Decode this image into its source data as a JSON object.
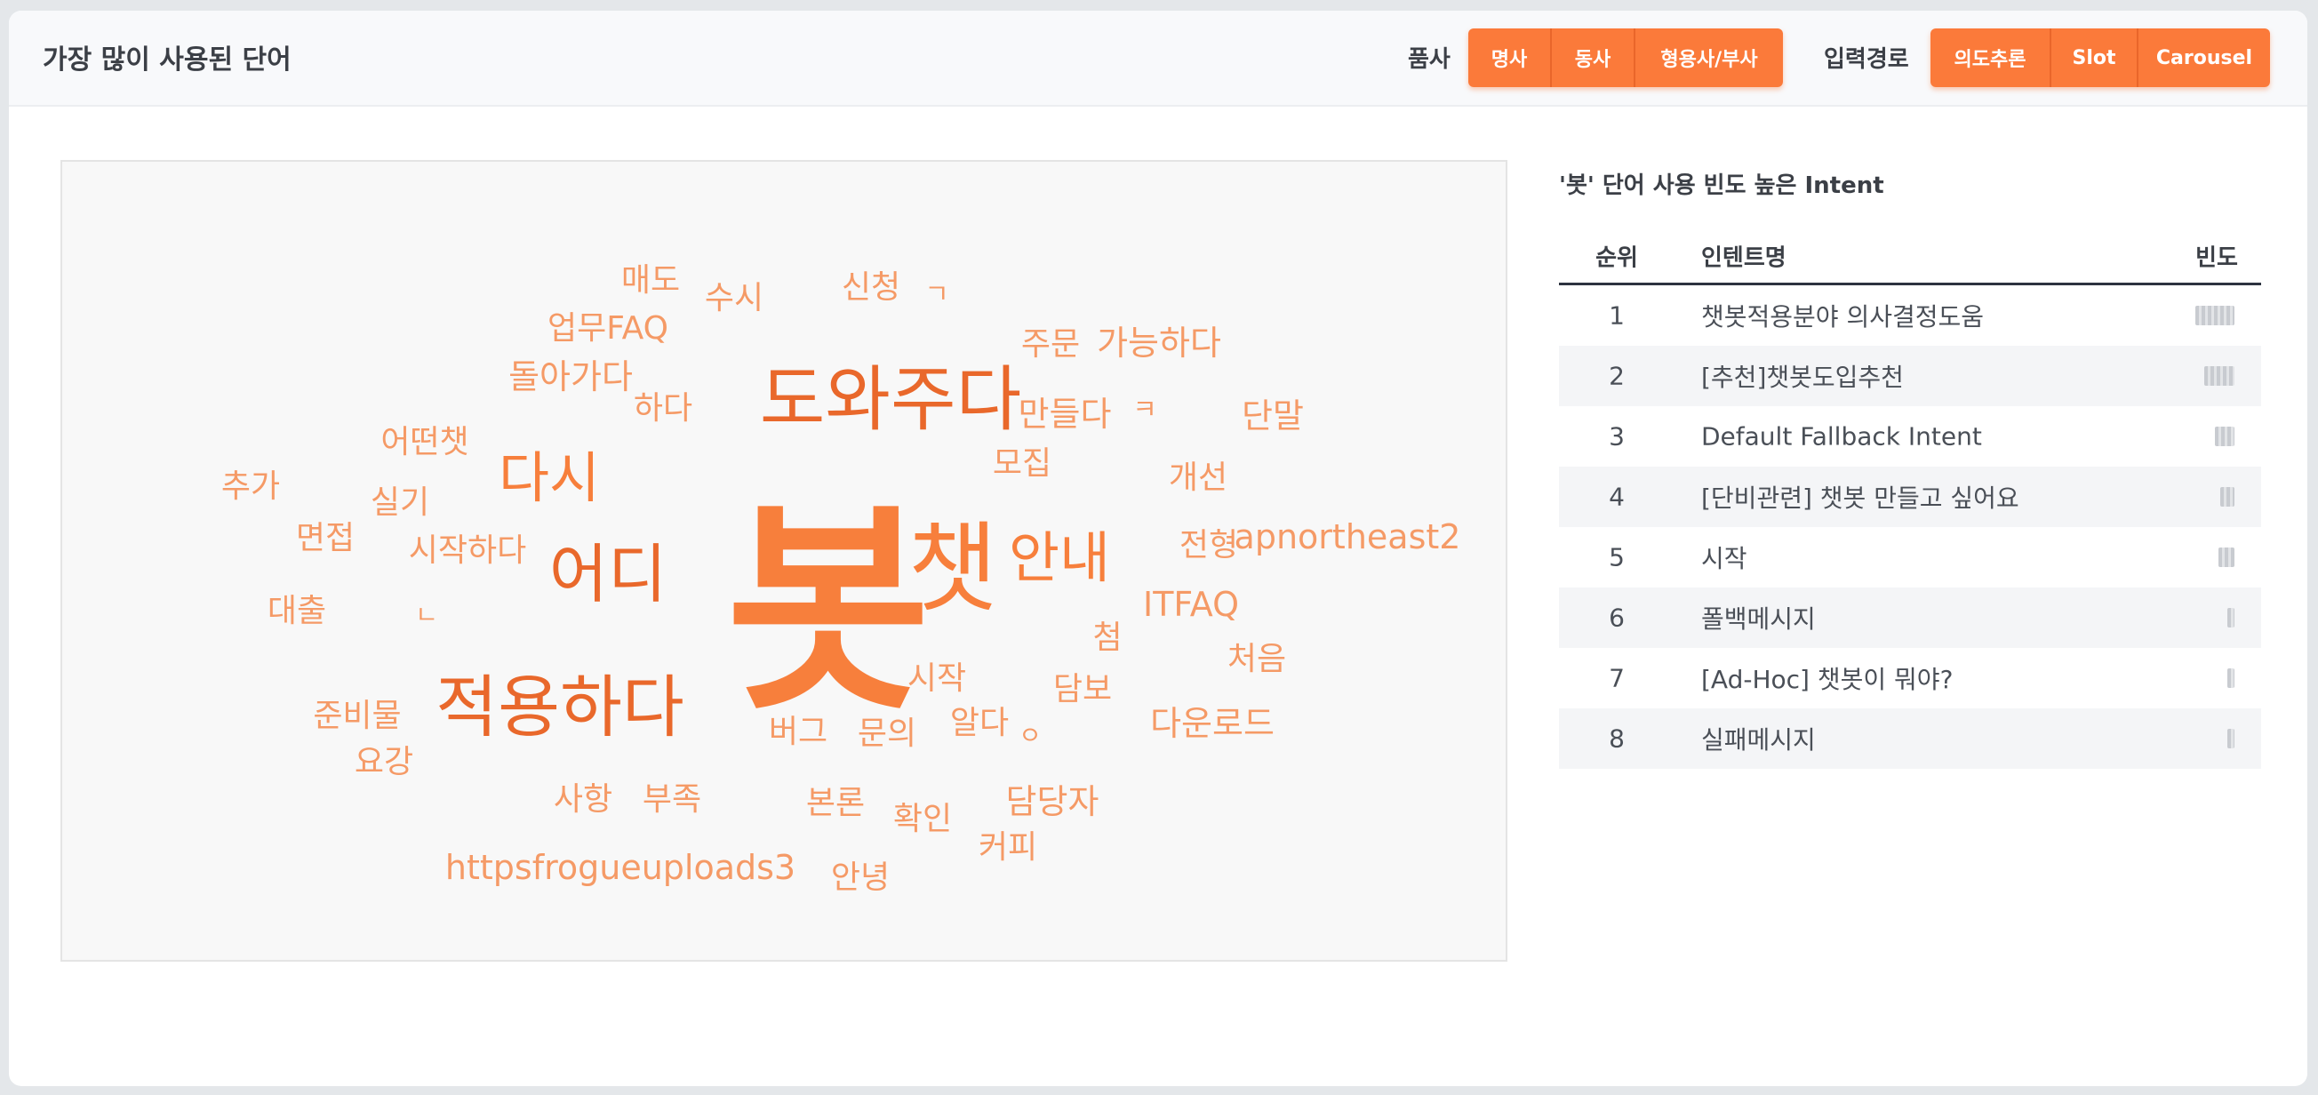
{
  "header": {
    "title": "가장 많이 사용된 단어",
    "pos_label": "품사",
    "pos_buttons": [
      "명사",
      "동사",
      "형용사/부사"
    ],
    "path_label": "입력경로",
    "path_buttons": [
      "의도추론",
      "Slot",
      "Carousel"
    ]
  },
  "colors": {
    "accent": "#fb7a3a",
    "word_dark": "#e9682b",
    "word_mid": "#f77f3c",
    "word_light": "#f59a66"
  },
  "wordcloud": {
    "words": [
      "봇",
      "챗",
      "도와주다",
      "적용하다",
      "어디",
      "안내",
      "다시",
      "매도",
      "수시",
      "신청",
      "ㄱ",
      "업무FAQ",
      "주문",
      "가능하다",
      "돌아가다",
      "하다",
      "만들다",
      "ㅋ",
      "단말",
      "어떤챗",
      "모집",
      "개선",
      "추가",
      "실기",
      "면접",
      "시작하다",
      "전형",
      "apnortheast2",
      "대출",
      "ㄴ",
      "ITFAQ",
      "첨",
      "처음",
      "시작",
      "담보",
      "준비물",
      "알다",
      "ㅇ",
      "버그",
      "문의",
      "다운로드",
      "요강",
      "사항",
      "부족",
      "본론",
      "확인",
      "담당자",
      "커피",
      "httpsfrogueuploads3",
      "안녕"
    ]
  },
  "table": {
    "title": "'봇' 단어 사용 빈도 높은 Intent",
    "columns": [
      "순위",
      "인텐트명",
      "빈도"
    ],
    "rows": [
      {
        "rank": "1",
        "name": "챗봇적용분야 의사결정도움"
      },
      {
        "rank": "2",
        "name": "[추천]챗봇도입추천"
      },
      {
        "rank": "3",
        "name": "Default Fallback Intent"
      },
      {
        "rank": "4",
        "name": "[단비관련] 챗봇 만들고 싶어요"
      },
      {
        "rank": "5",
        "name": "시작"
      },
      {
        "rank": "6",
        "name": "폴백메시지"
      },
      {
        "rank": "7",
        "name": "[Ad-Hoc] 챗봇이 뭐야?"
      },
      {
        "rank": "8",
        "name": "실패메시지"
      }
    ]
  }
}
